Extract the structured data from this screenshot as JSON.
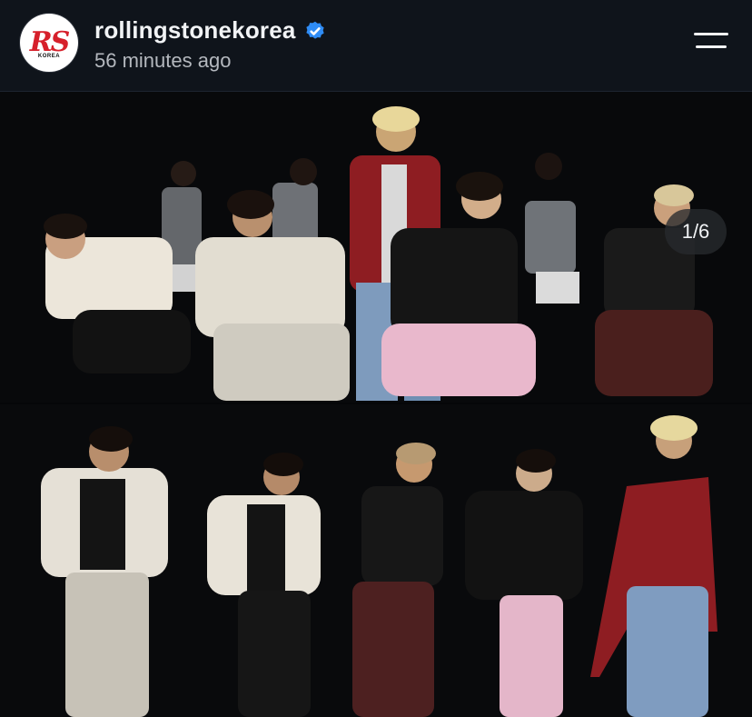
{
  "post_header": {
    "username": "rollingstonekorea",
    "timestamp": "56 minutes ago",
    "verified": true,
    "avatar": {
      "logo_text": "RS",
      "logo_subtext": "KOREA",
      "logo_color": "#d6202b"
    },
    "menu_icon": "hamburger-menu-icon"
  },
  "media": {
    "counter": "1/6",
    "description_icon": "photo-collage",
    "accent_colors": {
      "verified_badge": "#2f8cf5",
      "red_jacket": "#8e1d22",
      "pink_pants": "#e9b8cc",
      "white_jacket": "#e9e4da"
    }
  }
}
